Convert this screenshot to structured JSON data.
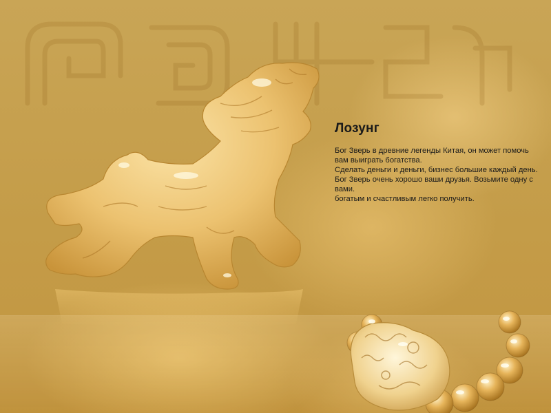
{
  "title": "Лозунг",
  "paragraphs": [
    "Бог Зверь в древние легенды Китая, он может помочь вам выиграть богатства.",
    "Сделать деньги и деньги, бизнес большие каждый день.",
    "Бог Зверь очень хорошо ваши друзья. Возьмите одну с вами.",
    "богатым и счастливым легко получить."
  ],
  "images": {
    "figurine": "jade-pixiu-figurine",
    "bracelet": "jade-pixiu-bead-bracelet",
    "background_pattern": "ancient-chinese-seal-pattern"
  },
  "colors": {
    "background": "#c9a24a",
    "jade": "#e9c47a",
    "text": "#1a1a1a"
  }
}
